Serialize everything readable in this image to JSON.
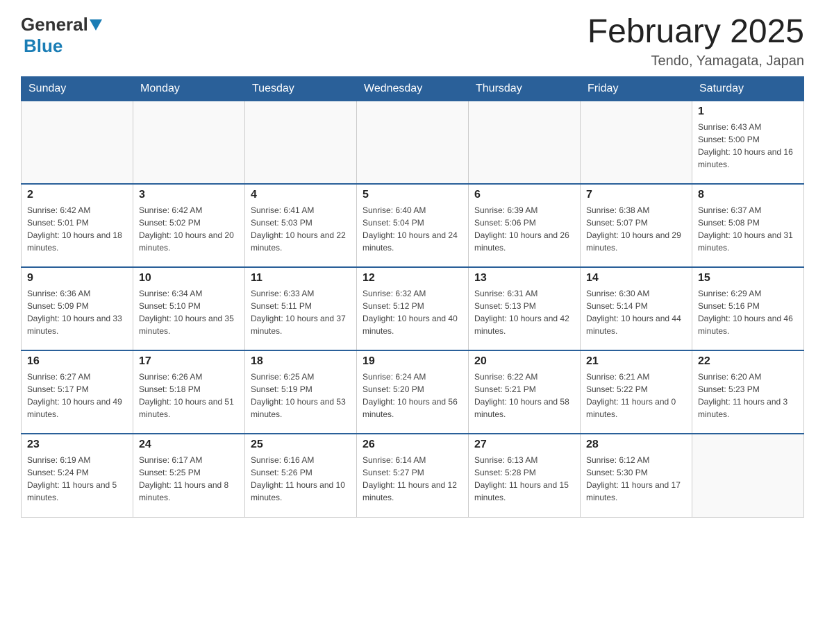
{
  "header": {
    "logo_general": "General",
    "logo_blue": "Blue",
    "month_title": "February 2025",
    "location": "Tendo, Yamagata, Japan"
  },
  "days_of_week": [
    "Sunday",
    "Monday",
    "Tuesday",
    "Wednesday",
    "Thursday",
    "Friday",
    "Saturday"
  ],
  "weeks": [
    [
      {
        "day": "",
        "info": ""
      },
      {
        "day": "",
        "info": ""
      },
      {
        "day": "",
        "info": ""
      },
      {
        "day": "",
        "info": ""
      },
      {
        "day": "",
        "info": ""
      },
      {
        "day": "",
        "info": ""
      },
      {
        "day": "1",
        "info": "Sunrise: 6:43 AM\nSunset: 5:00 PM\nDaylight: 10 hours and 16 minutes."
      }
    ],
    [
      {
        "day": "2",
        "info": "Sunrise: 6:42 AM\nSunset: 5:01 PM\nDaylight: 10 hours and 18 minutes."
      },
      {
        "day": "3",
        "info": "Sunrise: 6:42 AM\nSunset: 5:02 PM\nDaylight: 10 hours and 20 minutes."
      },
      {
        "day": "4",
        "info": "Sunrise: 6:41 AM\nSunset: 5:03 PM\nDaylight: 10 hours and 22 minutes."
      },
      {
        "day": "5",
        "info": "Sunrise: 6:40 AM\nSunset: 5:04 PM\nDaylight: 10 hours and 24 minutes."
      },
      {
        "day": "6",
        "info": "Sunrise: 6:39 AM\nSunset: 5:06 PM\nDaylight: 10 hours and 26 minutes."
      },
      {
        "day": "7",
        "info": "Sunrise: 6:38 AM\nSunset: 5:07 PM\nDaylight: 10 hours and 29 minutes."
      },
      {
        "day": "8",
        "info": "Sunrise: 6:37 AM\nSunset: 5:08 PM\nDaylight: 10 hours and 31 minutes."
      }
    ],
    [
      {
        "day": "9",
        "info": "Sunrise: 6:36 AM\nSunset: 5:09 PM\nDaylight: 10 hours and 33 minutes."
      },
      {
        "day": "10",
        "info": "Sunrise: 6:34 AM\nSunset: 5:10 PM\nDaylight: 10 hours and 35 minutes."
      },
      {
        "day": "11",
        "info": "Sunrise: 6:33 AM\nSunset: 5:11 PM\nDaylight: 10 hours and 37 minutes."
      },
      {
        "day": "12",
        "info": "Sunrise: 6:32 AM\nSunset: 5:12 PM\nDaylight: 10 hours and 40 minutes."
      },
      {
        "day": "13",
        "info": "Sunrise: 6:31 AM\nSunset: 5:13 PM\nDaylight: 10 hours and 42 minutes."
      },
      {
        "day": "14",
        "info": "Sunrise: 6:30 AM\nSunset: 5:14 PM\nDaylight: 10 hours and 44 minutes."
      },
      {
        "day": "15",
        "info": "Sunrise: 6:29 AM\nSunset: 5:16 PM\nDaylight: 10 hours and 46 minutes."
      }
    ],
    [
      {
        "day": "16",
        "info": "Sunrise: 6:27 AM\nSunset: 5:17 PM\nDaylight: 10 hours and 49 minutes."
      },
      {
        "day": "17",
        "info": "Sunrise: 6:26 AM\nSunset: 5:18 PM\nDaylight: 10 hours and 51 minutes."
      },
      {
        "day": "18",
        "info": "Sunrise: 6:25 AM\nSunset: 5:19 PM\nDaylight: 10 hours and 53 minutes."
      },
      {
        "day": "19",
        "info": "Sunrise: 6:24 AM\nSunset: 5:20 PM\nDaylight: 10 hours and 56 minutes."
      },
      {
        "day": "20",
        "info": "Sunrise: 6:22 AM\nSunset: 5:21 PM\nDaylight: 10 hours and 58 minutes."
      },
      {
        "day": "21",
        "info": "Sunrise: 6:21 AM\nSunset: 5:22 PM\nDaylight: 11 hours and 0 minutes."
      },
      {
        "day": "22",
        "info": "Sunrise: 6:20 AM\nSunset: 5:23 PM\nDaylight: 11 hours and 3 minutes."
      }
    ],
    [
      {
        "day": "23",
        "info": "Sunrise: 6:19 AM\nSunset: 5:24 PM\nDaylight: 11 hours and 5 minutes."
      },
      {
        "day": "24",
        "info": "Sunrise: 6:17 AM\nSunset: 5:25 PM\nDaylight: 11 hours and 8 minutes."
      },
      {
        "day": "25",
        "info": "Sunrise: 6:16 AM\nSunset: 5:26 PM\nDaylight: 11 hours and 10 minutes."
      },
      {
        "day": "26",
        "info": "Sunrise: 6:14 AM\nSunset: 5:27 PM\nDaylight: 11 hours and 12 minutes."
      },
      {
        "day": "27",
        "info": "Sunrise: 6:13 AM\nSunset: 5:28 PM\nDaylight: 11 hours and 15 minutes."
      },
      {
        "day": "28",
        "info": "Sunrise: 6:12 AM\nSunset: 5:30 PM\nDaylight: 11 hours and 17 minutes."
      },
      {
        "day": "",
        "info": ""
      }
    ]
  ]
}
